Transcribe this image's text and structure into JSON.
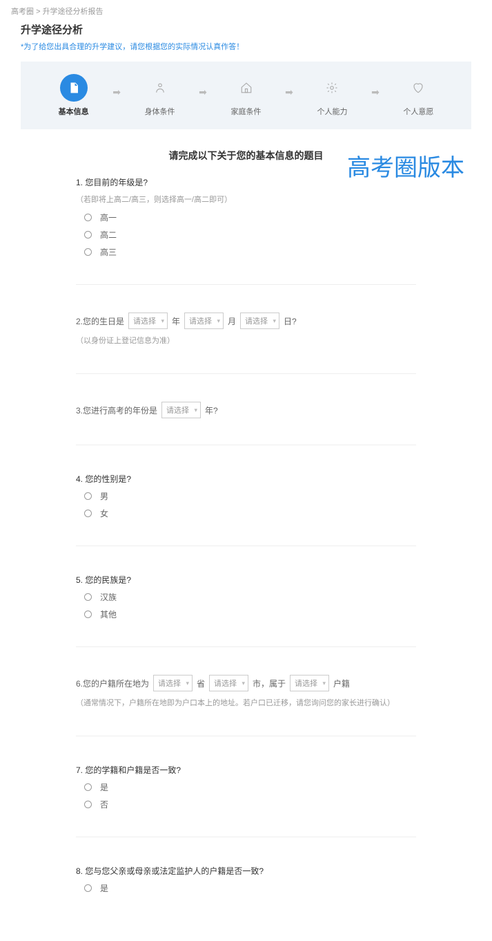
{
  "breadcrumb": {
    "item1": "高考圈",
    "sep": ">",
    "item2": "升学途径分析报告"
  },
  "page": {
    "title": "升学途径分析",
    "subtitle": "*为了给您出具合理的升学建议，请您根据您的实际情况认真作答！"
  },
  "watermark": "高考圈版本",
  "steps": {
    "s1": "基本信息",
    "s2": "身体条件",
    "s3": "家庭条件",
    "s4": "个人能力",
    "s5": "个人意愿"
  },
  "sectionTitle": "请完成以下关于您的基本信息的题目",
  "q1": {
    "title": "1. 您目前的年级是?",
    "hint": "（若即将上高二/高三，则选择高一/高二即可）",
    "o1": "高一",
    "o2": "高二",
    "o3": "高三"
  },
  "q2": {
    "prefix": "2.您的生日是",
    "ph": "请选择",
    "y": "年",
    "m": "月",
    "d": "日?",
    "hint": "（以身份证上登记信息为准）"
  },
  "q3": {
    "prefix": "3.您进行高考的年份是",
    "ph": "请选择",
    "suffix": "年?"
  },
  "q4": {
    "title": "4. 您的性别是?",
    "o1": "男",
    "o2": "女"
  },
  "q5": {
    "title": "5. 您的民族是?",
    "o1": "汉族",
    "o2": "其他"
  },
  "q6": {
    "prefix": "6.您的户籍所在地为",
    "ph": "请选择",
    "prov": "省",
    "city": "市，属于",
    "suffix": "户籍",
    "hint": "（通常情况下，户籍所在地即为户口本上的地址。若户口已迁移，请您询问您的家长进行确认）"
  },
  "q7": {
    "title": "7. 您的学籍和户籍是否一致?",
    "o1": "是",
    "o2": "否"
  },
  "q8": {
    "title": "8. 您与您父亲或母亲或法定监护人的户籍是否一致?",
    "o1": "是"
  }
}
